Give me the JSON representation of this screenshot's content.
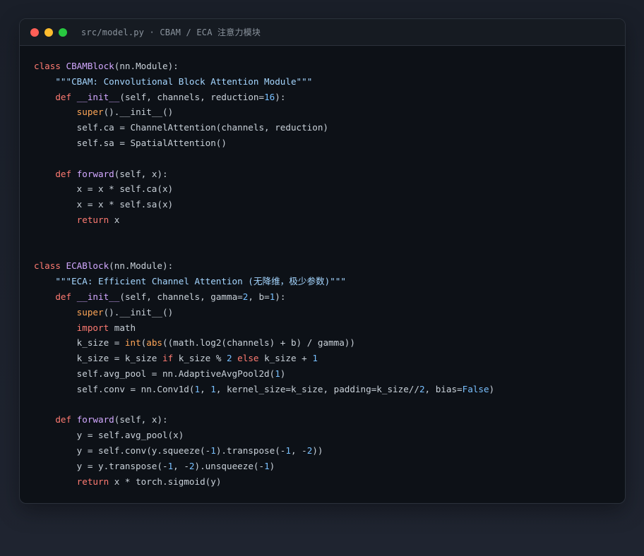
{
  "window": {
    "title": "src/model.py · CBAM / ECA 注意力模块",
    "controls": [
      "close-dot",
      "minimize-dot",
      "maximize-dot"
    ]
  },
  "colors": {
    "keyword": "#ff7b72",
    "builtin": "#ffa657",
    "definition": "#d2a8ff",
    "string": "#a5d6ff",
    "number": "#79c0ff",
    "text": "#c9d1d9",
    "background": "#0d1117"
  },
  "code": {
    "lines": [
      [
        [
          "kw",
          "class "
        ],
        [
          "cls",
          "CBAMBlock"
        ],
        [
          "tx",
          "(nn.Module):"
        ]
      ],
      [
        [
          "tx",
          "    "
        ],
        [
          "str",
          "\"\"\"CBAM: Convolutional Block Attention Module\"\"\""
        ]
      ],
      [
        [
          "tx",
          "    "
        ],
        [
          "kw",
          "def "
        ],
        [
          "fn",
          "__init__"
        ],
        [
          "tx",
          "(self, channels, reduction="
        ],
        [
          "num",
          "16"
        ],
        [
          "tx",
          "):"
        ]
      ],
      [
        [
          "tx",
          "        "
        ],
        [
          "bi",
          "super"
        ],
        [
          "tx",
          "().__init__()"
        ]
      ],
      [
        [
          "tx",
          "        self.ca = ChannelAttention(channels, reduction)"
        ]
      ],
      [
        [
          "tx",
          "        self.sa = SpatialAttention()"
        ]
      ],
      [],
      [
        [
          "tx",
          "    "
        ],
        [
          "kw",
          "def "
        ],
        [
          "fn",
          "forward"
        ],
        [
          "tx",
          "(self, x):"
        ]
      ],
      [
        [
          "tx",
          "        x = x * self.ca(x)"
        ]
      ],
      [
        [
          "tx",
          "        x = x * self.sa(x)"
        ]
      ],
      [
        [
          "tx",
          "        "
        ],
        [
          "kw",
          "return"
        ],
        [
          "tx",
          " x"
        ]
      ],
      [],
      [],
      [
        [
          "kw",
          "class "
        ],
        [
          "cls",
          "ECABlock"
        ],
        [
          "tx",
          "(nn.Module):"
        ]
      ],
      [
        [
          "tx",
          "    "
        ],
        [
          "str",
          "\"\"\"ECA: Efficient Channel Attention (无降维，极少参数)\"\"\""
        ]
      ],
      [
        [
          "tx",
          "    "
        ],
        [
          "kw",
          "def "
        ],
        [
          "fn",
          "__init__"
        ],
        [
          "tx",
          "(self, channels, gamma="
        ],
        [
          "num",
          "2"
        ],
        [
          "tx",
          ", b="
        ],
        [
          "num",
          "1"
        ],
        [
          "tx",
          "):"
        ]
      ],
      [
        [
          "tx",
          "        "
        ],
        [
          "bi",
          "super"
        ],
        [
          "tx",
          "().__init__()"
        ]
      ],
      [
        [
          "tx",
          "        "
        ],
        [
          "kw",
          "import"
        ],
        [
          "tx",
          " math"
        ]
      ],
      [
        [
          "tx",
          "        k_size = "
        ],
        [
          "bi",
          "int"
        ],
        [
          "tx",
          "("
        ],
        [
          "bi",
          "abs"
        ],
        [
          "tx",
          "((math.log2(channels) + b) / gamma))"
        ]
      ],
      [
        [
          "tx",
          "        k_size = k_size "
        ],
        [
          "kw",
          "if"
        ],
        [
          "tx",
          " k_size % "
        ],
        [
          "num",
          "2"
        ],
        [
          "tx",
          " "
        ],
        [
          "kw",
          "else"
        ],
        [
          "tx",
          " k_size + "
        ],
        [
          "num",
          "1"
        ]
      ],
      [
        [
          "tx",
          "        self.avg_pool = nn.AdaptiveAvgPool2d("
        ],
        [
          "num",
          "1"
        ],
        [
          "tx",
          ")"
        ]
      ],
      [
        [
          "tx",
          "        self.conv = nn.Conv1d("
        ],
        [
          "num",
          "1"
        ],
        [
          "tx",
          ", "
        ],
        [
          "num",
          "1"
        ],
        [
          "tx",
          ", kernel_size=k_size, padding=k_size//"
        ],
        [
          "num",
          "2"
        ],
        [
          "tx",
          ", bias="
        ],
        [
          "num",
          "False"
        ],
        [
          "tx",
          ")"
        ]
      ],
      [],
      [
        [
          "tx",
          "    "
        ],
        [
          "kw",
          "def "
        ],
        [
          "fn",
          "forward"
        ],
        [
          "tx",
          "(self, x):"
        ]
      ],
      [
        [
          "tx",
          "        y = self.avg_pool(x)"
        ]
      ],
      [
        [
          "tx",
          "        y = self.conv(y.squeeze(-"
        ],
        [
          "num",
          "1"
        ],
        [
          "tx",
          ").transpose(-"
        ],
        [
          "num",
          "1"
        ],
        [
          "tx",
          ", -"
        ],
        [
          "num",
          "2"
        ],
        [
          "tx",
          "))"
        ]
      ],
      [
        [
          "tx",
          "        y = y.transpose(-"
        ],
        [
          "num",
          "1"
        ],
        [
          "tx",
          ", -"
        ],
        [
          "num",
          "2"
        ],
        [
          "tx",
          ").unsqueeze(-"
        ],
        [
          "num",
          "1"
        ],
        [
          "tx",
          ")"
        ]
      ],
      [
        [
          "tx",
          "        "
        ],
        [
          "kw",
          "return"
        ],
        [
          "tx",
          " x * torch.sigmoid(y)"
        ]
      ]
    ]
  }
}
